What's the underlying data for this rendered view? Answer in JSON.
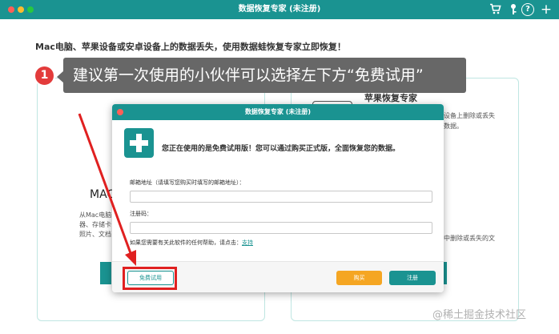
{
  "window": {
    "title": "数据恢复专家 (未注册)",
    "toolbar_icons": {
      "cart": "cart-icon",
      "key": "key-icon",
      "help": "help-icon",
      "add": "plus-icon"
    },
    "help_glyph": "?",
    "add_glyph": "+"
  },
  "main": {
    "headline": "Mac电脑、苹果设备或安卓设备上的数据丢失，使用数据蛙恢复专家立即恢复！",
    "left_card": {
      "title": "MAC",
      "desc_lines": [
        "从Mac电脑",
        "器、存储卡",
        "照片、文档"
      ]
    },
    "right_card": {
      "title": "苹果恢复专家",
      "desc_lines": [
        "设备上删除或丢失",
        "数据。",
        "中删除或丢失的文"
      ]
    }
  },
  "tooltip": {
    "step_number": "1",
    "text": "建议第一次使用的小伙伴可以选择左下方“免费试用”"
  },
  "dialog": {
    "title": "数据恢复专家 (未注册)",
    "message": "您正在使用的是免费试用版！您可以通过购买正式版，全面恢复您的数据。",
    "email_label": "邮箱地址（请填写您购买时填写的邮箱地址）：",
    "email_value": "",
    "code_label": "注册码：",
    "code_value": "",
    "help_text": "如果您需要有关此软件的任何帮助，请点击：",
    "support_link": "支持",
    "trial_button": "免费试用",
    "buy_button": "购买",
    "register_button": "注册"
  },
  "watermark": "@稀土掘金技术社区",
  "colors": {
    "accent": "#1a9391",
    "buy": "#f5a623",
    "annotation": "#e02020",
    "tooltip_bg": "#676767"
  }
}
